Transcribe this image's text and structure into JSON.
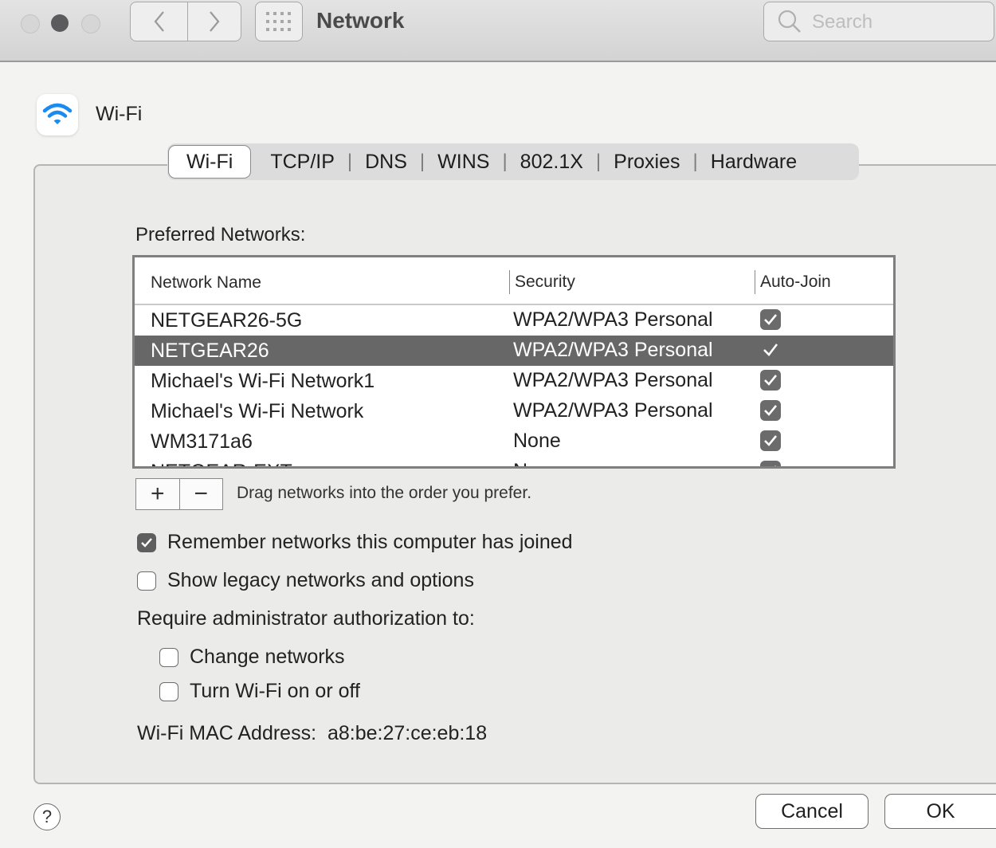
{
  "window": {
    "title": "Network",
    "search_placeholder": "Search"
  },
  "header": {
    "title": "Wi-Fi",
    "icon": "wifi-icon",
    "accent": "#1a8cf0"
  },
  "tabs": [
    "Wi-Fi",
    "TCP/IP",
    "DNS",
    "WINS",
    "802.1X",
    "Proxies",
    "Hardware"
  ],
  "preferred": {
    "label": "Preferred Networks:",
    "columns": [
      "Network Name",
      "Security",
      "Auto-Join"
    ],
    "rows": [
      {
        "name": "NETGEAR26-5G",
        "security": "WPA2/WPA3 Personal",
        "auto_join": true,
        "selected": false
      },
      {
        "name": "NETGEAR26",
        "security": "WPA2/WPA3 Personal",
        "auto_join": true,
        "selected": true
      },
      {
        "name": "Michael's Wi-Fi Network1",
        "security": "WPA2/WPA3 Personal",
        "auto_join": true,
        "selected": false
      },
      {
        "name": "Michael's Wi-Fi Network",
        "security": "WPA2/WPA3 Personal",
        "auto_join": true,
        "selected": false
      },
      {
        "name": "WM3171a6",
        "security": "None",
        "auto_join": true,
        "selected": false
      },
      {
        "name": "NETGEAR-EXT",
        "security": "None",
        "auto_join": true,
        "selected": false
      }
    ],
    "add_label": "+",
    "remove_label": "−",
    "drag_hint": "Drag networks into the order you prefer."
  },
  "options": {
    "remember_label": "Remember networks this computer has joined",
    "remember_checked": true,
    "legacy_label": "Show legacy networks and options",
    "legacy_checked": false,
    "require_label": "Require administrator authorization to:",
    "change_label": "Change networks",
    "change_checked": false,
    "toggle_label": "Turn Wi-Fi on or off",
    "toggle_checked": false
  },
  "mac": {
    "label": "Wi-Fi MAC Address:",
    "value": "a8:be:27:ce:eb:18"
  },
  "buttons": {
    "help": "?",
    "cancel": "Cancel",
    "ok": "OK"
  }
}
